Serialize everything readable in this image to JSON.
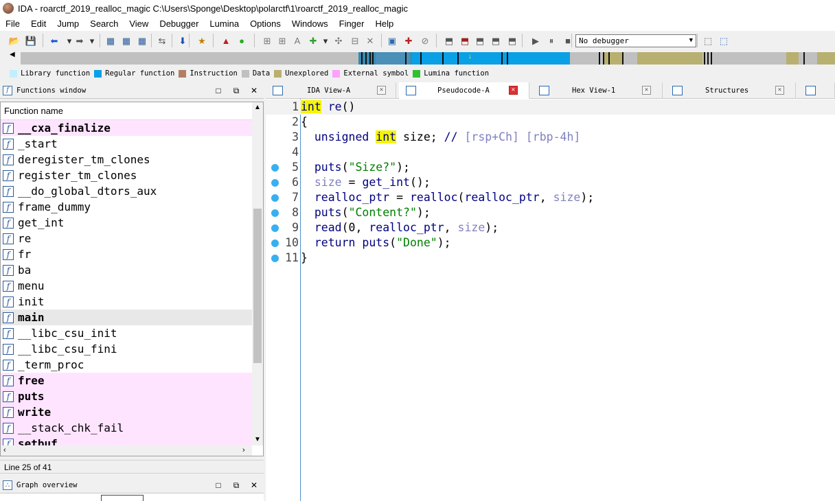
{
  "title": "IDA - roarctf_2019_realloc_magic C:\\Users\\Sponge\\Desktop\\polarctf\\1\\roarctf_2019_realloc_magic",
  "menu": [
    "File",
    "Edit",
    "Jump",
    "Search",
    "View",
    "Debugger",
    "Lumina",
    "Options",
    "Windows",
    "Finger",
    "Help"
  ],
  "debugger_select": "No debugger",
  "legend": [
    {
      "label": "Library function",
      "color": "#c0f0ff"
    },
    {
      "label": "Regular function",
      "color": "#0aa0e6"
    },
    {
      "label": "Instruction",
      "color": "#b08060"
    },
    {
      "label": "Data",
      "color": "#c0c0c0"
    },
    {
      "label": "Unexplored",
      "color": "#b8b070"
    },
    {
      "label": "External symbol",
      "color": "#ffa0ff"
    },
    {
      "label": "Lumina function",
      "color": "#30c030"
    }
  ],
  "functions_window": {
    "title": "Functions window",
    "column_header": "Function name",
    "rows": [
      {
        "name": "__cxa_finalize",
        "style": "ext bold"
      },
      {
        "name": "_start",
        "style": ""
      },
      {
        "name": "deregister_tm_clones",
        "style": ""
      },
      {
        "name": "register_tm_clones",
        "style": ""
      },
      {
        "name": "__do_global_dtors_aux",
        "style": ""
      },
      {
        "name": "frame_dummy",
        "style": ""
      },
      {
        "name": "get_int",
        "style": ""
      },
      {
        "name": "re",
        "style": ""
      },
      {
        "name": "fr",
        "style": ""
      },
      {
        "name": "ba",
        "style": ""
      },
      {
        "name": "menu",
        "style": ""
      },
      {
        "name": "init",
        "style": ""
      },
      {
        "name": "main",
        "style": "sel bold"
      },
      {
        "name": "__libc_csu_init",
        "style": ""
      },
      {
        "name": "__libc_csu_fini",
        "style": ""
      },
      {
        "name": "_term_proc",
        "style": ""
      },
      {
        "name": "free",
        "style": "ext bold"
      },
      {
        "name": "puts",
        "style": "ext bold"
      },
      {
        "name": "write",
        "style": "ext bold"
      },
      {
        "name": "__stack_chk_fail",
        "style": "ext"
      },
      {
        "name": "setbuf",
        "style": "ext bold"
      }
    ],
    "status": "Line 25 of 41"
  },
  "graph_overview": {
    "title": "Graph overview"
  },
  "tabs": [
    {
      "label": "IDA View-A",
      "active": false
    },
    {
      "label": "Pseudocode-A",
      "active": true
    },
    {
      "label": "Hex View-1",
      "active": false
    },
    {
      "label": "Structures",
      "active": false
    }
  ],
  "code": {
    "lines": [
      {
        "n": "1",
        "dot": false,
        "html": "<span class='hl kw'>int</span> <span class='fnc'>re</span>()"
      },
      {
        "n": "2",
        "dot": false,
        "html": "{"
      },
      {
        "n": "3",
        "dot": false,
        "html": "  <span class='kw'>unsigned</span> <span class='hl kw'>int</span> size; <span class='cm'>//</span> <span class='cmv'>[rsp+Ch] [rbp-4h]</span>"
      },
      {
        "n": "4",
        "dot": false,
        "html": ""
      },
      {
        "n": "5",
        "dot": true,
        "html": "  <span class='fnc'>puts</span>(<span class='str'>\"Size?\"</span>);"
      },
      {
        "n": "6",
        "dot": true,
        "html": "  <span class='var'>size</span> = <span class='fnc'>get_int</span>();"
      },
      {
        "n": "7",
        "dot": true,
        "html": "  <span class='fnc'>realloc_ptr</span> = <span class='fnc'>realloc</span>(<span class='fnc'>realloc_ptr</span>, <span class='var'>size</span>);"
      },
      {
        "n": "8",
        "dot": true,
        "html": "  <span class='fnc'>puts</span>(<span class='str'>\"Content?\"</span>);"
      },
      {
        "n": "9",
        "dot": true,
        "html": "  <span class='fnc'>read</span>(0, <span class='fnc'>realloc_ptr</span>, <span class='var'>size</span>);"
      },
      {
        "n": "10",
        "dot": true,
        "html": "  <span class='kw'>return</span> <span class='fnc'>puts</span>(<span class='str'>\"Done\"</span>);"
      },
      {
        "n": "11",
        "dot": true,
        "html": "}"
      }
    ]
  }
}
